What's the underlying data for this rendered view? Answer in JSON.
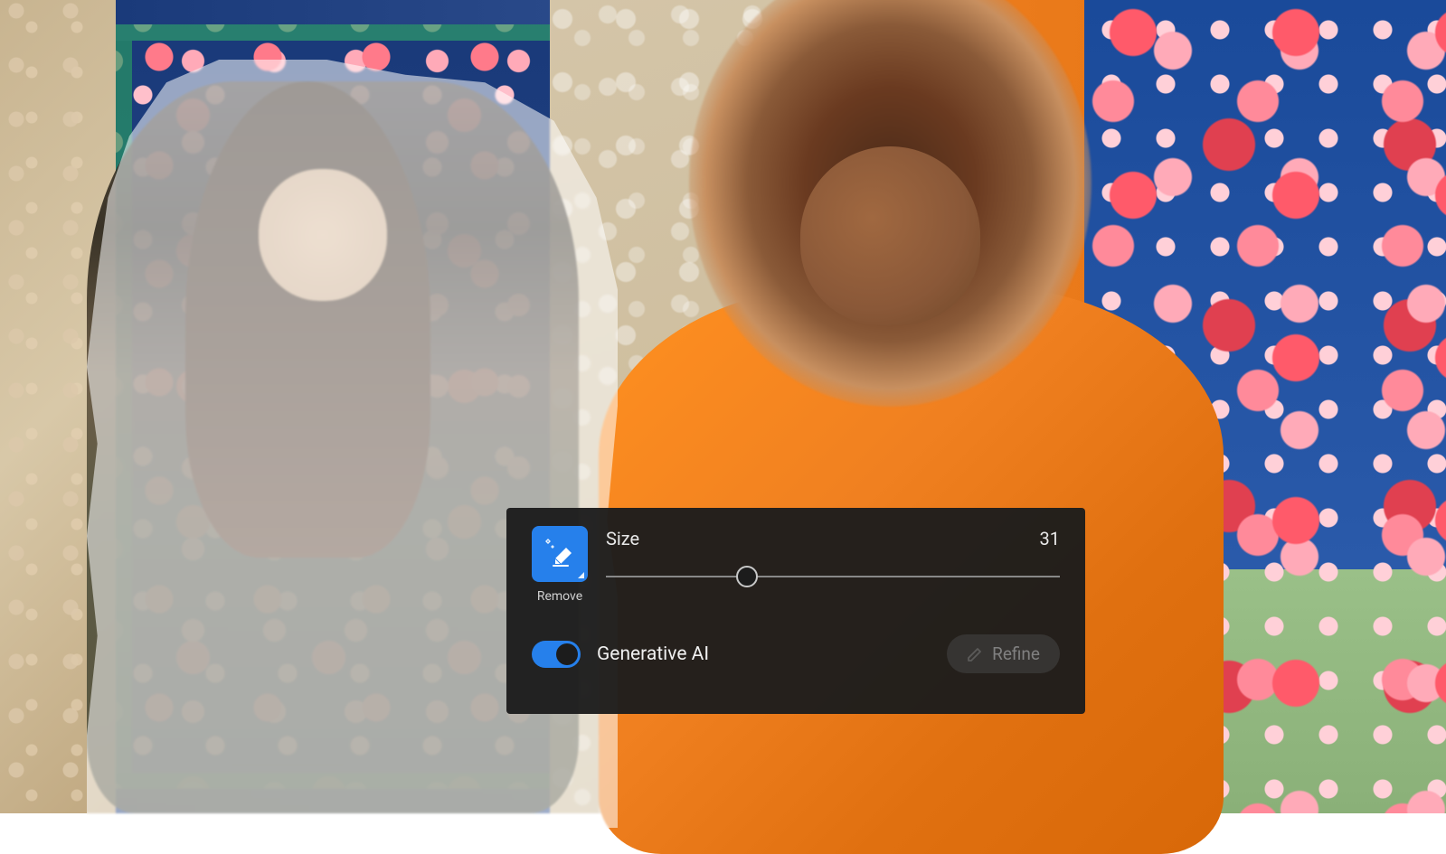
{
  "tool": {
    "icon_name": "eraser-sparkle-icon",
    "label": "Remove",
    "accent_color": "#2680eb"
  },
  "slider": {
    "label": "Size",
    "value": "31",
    "percent": 31
  },
  "toggle": {
    "label": "Generative AI",
    "state": "on"
  },
  "refine": {
    "label": "Refine",
    "enabled": false
  }
}
